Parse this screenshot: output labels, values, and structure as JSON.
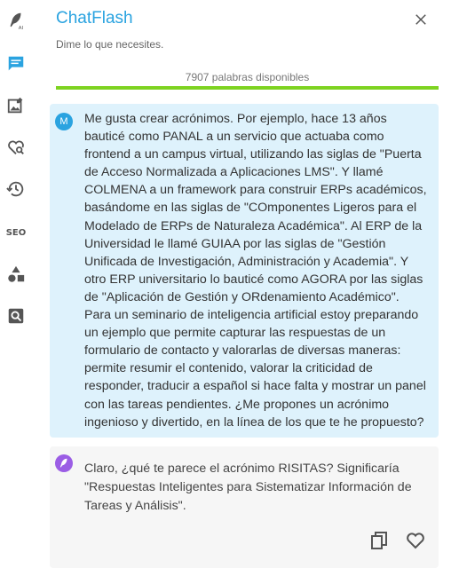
{
  "header": {
    "title": "ChatFlash",
    "subtitle": "Dime lo que necesites."
  },
  "sidebar": {
    "items": [
      {
        "icon": "feather-ai-icon"
      },
      {
        "icon": "chat-icon"
      },
      {
        "icon": "image-edit-icon"
      },
      {
        "icon": "heart-search-icon"
      },
      {
        "icon": "history-icon"
      },
      {
        "label": "SEO"
      },
      {
        "icon": "shapes-icon"
      },
      {
        "icon": "search-document-icon"
      }
    ]
  },
  "usage": {
    "words_text": "7907 palabras disponibles",
    "fill_percent": 100
  },
  "messages": [
    {
      "role": "user",
      "avatar_letter": "M",
      "text": "Me gusta crear acrónimos. Por ejemplo, hace 13 años\nbauticé como PANAL a un servicio que actuaba como\nfrontend a un campus virtual, utilizando las siglas de \"Puerta\nde Acceso Normalizada a Aplicaciones LMS\". Y llamé\nCOLMENA a un framework para construir ERPs académicos,\nbasándome en las siglas de \"COmponentes Ligeros para el\nModelado de ERPs de Naturaleza Académica\". Al ERP de la\nUniversidad le llamé GUIAA por las siglas de \"Gestión\nUnificada de Investigación, Administración y Academia\". Y\notro ERP universitario lo bauticé como AGORA por las siglas\nde \"Aplicación de Gestión y ORdenamiento Académico\".\nPara un seminario de inteligencia artificial estoy preparando\nun ejemplo que permite capturar las respuestas de un\nformulario de contacto y valorarlas de diversas maneras:\npermite resumir el contenido, valorar la criticidad de\nresponder, traducir a español si hace falta y mostrar un panel\ncon las tareas pendientes. ¿Me propones un acrónimo\ningenioso y divertido, en la línea de los que te he propuesto?"
    },
    {
      "role": "assistant",
      "text": "Claro, ¿qué te parece el acrónimo RISITAS? Significaría\n\"Respuestas Inteligentes para Sistematizar Información de\nTareas y Análisis\"."
    }
  ],
  "colors": {
    "accent": "#2aa3e0",
    "progress": "#7ed321",
    "user_bubble": "#def2fc",
    "bot_bubble": "#f6f6f6",
    "bot_avatar": "#9b5de5"
  }
}
